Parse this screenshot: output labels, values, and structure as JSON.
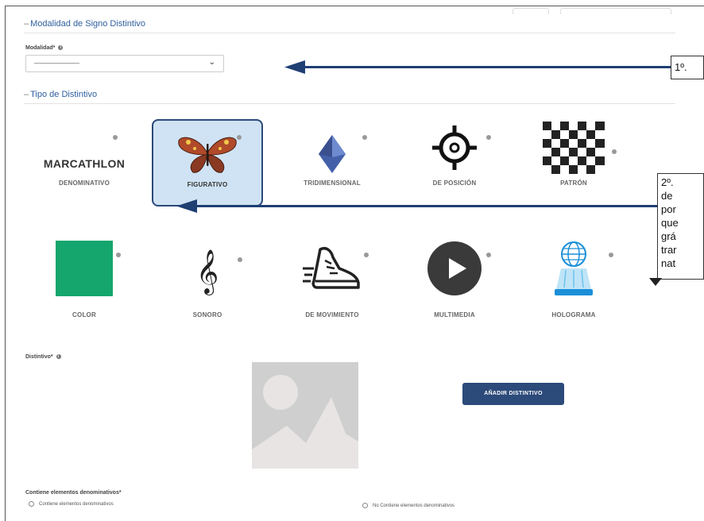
{
  "modalidad_section": {
    "title": "Modalidad de Signo Distintivo",
    "field_label": "Modalidad",
    "required_mark": "*",
    "selected_value": "———————"
  },
  "tipo_section": {
    "title": "Tipo de Distintivo",
    "tiles": [
      {
        "label": "DENOMINATIVO",
        "sample_text": "MARCATHLON",
        "icon": "text-sample"
      },
      {
        "label": "FIGURATIVO",
        "icon": "butterfly-icon",
        "selected": true
      },
      {
        "label": "TRIDIMENSIONAL",
        "icon": "diamond-3d-icon"
      },
      {
        "label": "DE POSICIÓN",
        "icon": "crosshair-icon"
      },
      {
        "label": "PATRÓN",
        "icon": "checker-pattern-icon"
      },
      {
        "label": "COLOR",
        "icon": "color-swatch-icon"
      },
      {
        "label": "SONORO",
        "icon": "treble-clef-icon"
      },
      {
        "label": "DE MOVIMIENTO",
        "icon": "running-shoe-icon"
      },
      {
        "label": "MULTIMEDIA",
        "icon": "play-icon"
      },
      {
        "label": "HOLOGRAMA",
        "icon": "hologram-globe-icon"
      }
    ]
  },
  "distintivo": {
    "field_label": "Distintivo",
    "required_mark": "*",
    "add_button_label": "AÑADIR DISTINTIVO",
    "placeholder_icon": "image-placeholder-icon"
  },
  "denominativos": {
    "question": "Contiene elementos denominativos",
    "required_mark": "*",
    "option_yes": "Contiene elementos denominativos",
    "option_no": "No Contiene elementos denominativos"
  },
  "callouts": {
    "first": "1º.",
    "second_lines": [
      "2º.",
      "de",
      "por",
      "que",
      "grá",
      "trar",
      "nat"
    ]
  },
  "colors": {
    "accent": "#2c4a7a",
    "section_title": "#2f5f9e",
    "selected_bg": "#cfe3f4",
    "color_swatch": "#14a66c",
    "arrow": "#1f3f73"
  }
}
